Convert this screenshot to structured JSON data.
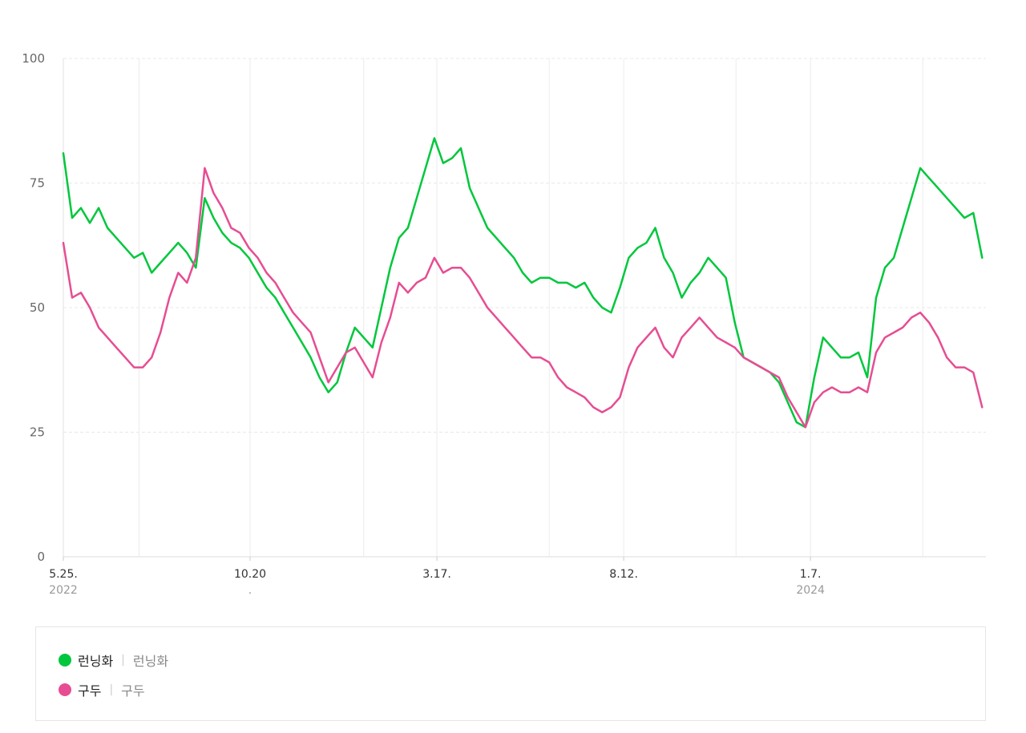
{
  "chart_data": {
    "type": "line",
    "title": "",
    "xlabel": "",
    "ylabel": "",
    "ylim": [
      0,
      100
    ],
    "yticks": [
      "0",
      "25",
      "50",
      "75",
      "100"
    ],
    "xlim": [
      "2022-05-25",
      "2024-05-25"
    ],
    "xticks": [
      {
        "date": "2022-05-25",
        "label": "5.25.",
        "sub": "2022"
      },
      {
        "date": "2022-10-20",
        "label": "10.20",
        "sub": "."
      },
      {
        "date": "2023-03-17",
        "label": "3.17.",
        "sub": ""
      },
      {
        "date": "2023-08-12",
        "label": "8.12.",
        "sub": ""
      },
      {
        "date": "2024-01-07",
        "label": "1.7.",
        "sub": "2024"
      }
    ],
    "vgrid_dates": [
      "2022-07-24",
      "2022-10-20",
      "2023-01-18",
      "2023-03-17",
      "2023-06-14",
      "2023-08-12",
      "2023-11-09",
      "2024-01-07",
      "2024-04-05"
    ],
    "grid": true,
    "legend_position": "bottom",
    "series": [
      {
        "name": "런닝화",
        "color": "#00c73c",
        "points": [
          [
            "2022-05-25",
            81
          ],
          [
            "2022-06-01",
            68
          ],
          [
            "2022-06-08",
            70
          ],
          [
            "2022-06-15",
            67
          ],
          [
            "2022-06-22",
            70
          ],
          [
            "2022-06-29",
            66
          ],
          [
            "2022-07-06",
            64
          ],
          [
            "2022-07-13",
            62
          ],
          [
            "2022-07-20",
            60
          ],
          [
            "2022-07-27",
            61
          ],
          [
            "2022-08-03",
            57
          ],
          [
            "2022-08-10",
            59
          ],
          [
            "2022-08-17",
            61
          ],
          [
            "2022-08-24",
            63
          ],
          [
            "2022-08-31",
            61
          ],
          [
            "2022-09-07",
            58
          ],
          [
            "2022-09-14",
            72
          ],
          [
            "2022-09-21",
            68
          ],
          [
            "2022-09-28",
            65
          ],
          [
            "2022-10-05",
            63
          ],
          [
            "2022-10-12",
            62
          ],
          [
            "2022-10-19",
            60
          ],
          [
            "2022-10-26",
            57
          ],
          [
            "2022-11-02",
            54
          ],
          [
            "2022-11-09",
            52
          ],
          [
            "2022-11-16",
            49
          ],
          [
            "2022-11-23",
            46
          ],
          [
            "2022-11-30",
            43
          ],
          [
            "2022-12-07",
            40
          ],
          [
            "2022-12-14",
            36
          ],
          [
            "2022-12-21",
            33
          ],
          [
            "2022-12-28",
            35
          ],
          [
            "2023-01-04",
            41
          ],
          [
            "2023-01-11",
            46
          ],
          [
            "2023-01-18",
            44
          ],
          [
            "2023-01-25",
            42
          ],
          [
            "2023-02-01",
            50
          ],
          [
            "2023-02-08",
            58
          ],
          [
            "2023-02-15",
            64
          ],
          [
            "2023-02-22",
            66
          ],
          [
            "2023-03-01",
            72
          ],
          [
            "2023-03-08",
            78
          ],
          [
            "2023-03-15",
            84
          ],
          [
            "2023-03-22",
            79
          ],
          [
            "2023-03-29",
            80
          ],
          [
            "2023-04-05",
            82
          ],
          [
            "2023-04-12",
            74
          ],
          [
            "2023-04-19",
            70
          ],
          [
            "2023-04-26",
            66
          ],
          [
            "2023-05-03",
            64
          ],
          [
            "2023-05-10",
            62
          ],
          [
            "2023-05-17",
            60
          ],
          [
            "2023-05-24",
            57
          ],
          [
            "2023-05-31",
            55
          ],
          [
            "2023-06-07",
            56
          ],
          [
            "2023-06-14",
            56
          ],
          [
            "2023-06-21",
            55
          ],
          [
            "2023-06-28",
            55
          ],
          [
            "2023-07-05",
            54
          ],
          [
            "2023-07-12",
            55
          ],
          [
            "2023-07-19",
            52
          ],
          [
            "2023-07-26",
            50
          ],
          [
            "2023-08-02",
            49
          ],
          [
            "2023-08-09",
            54
          ],
          [
            "2023-08-16",
            60
          ],
          [
            "2023-08-23",
            62
          ],
          [
            "2023-08-30",
            63
          ],
          [
            "2023-09-06",
            66
          ],
          [
            "2023-09-13",
            60
          ],
          [
            "2023-09-20",
            57
          ],
          [
            "2023-09-27",
            52
          ],
          [
            "2023-10-04",
            55
          ],
          [
            "2023-10-11",
            57
          ],
          [
            "2023-10-18",
            60
          ],
          [
            "2023-10-25",
            58
          ],
          [
            "2023-11-01",
            56
          ],
          [
            "2023-11-08",
            47
          ],
          [
            "2023-11-15",
            40
          ],
          [
            "2023-11-22",
            39
          ],
          [
            "2023-11-29",
            38
          ],
          [
            "2023-12-06",
            37
          ],
          [
            "2023-12-13",
            35
          ],
          [
            "2023-12-20",
            31
          ],
          [
            "2023-12-27",
            27
          ],
          [
            "2024-01-03",
            26
          ],
          [
            "2024-01-10",
            36
          ],
          [
            "2024-01-17",
            44
          ],
          [
            "2024-01-24",
            42
          ],
          [
            "2024-01-31",
            40
          ],
          [
            "2024-02-07",
            40
          ],
          [
            "2024-02-14",
            41
          ],
          [
            "2024-02-21",
            36
          ],
          [
            "2024-02-28",
            52
          ],
          [
            "2024-03-06",
            58
          ],
          [
            "2024-03-13",
            60
          ],
          [
            "2024-03-20",
            66
          ],
          [
            "2024-03-27",
            72
          ],
          [
            "2024-04-03",
            78
          ],
          [
            "2024-04-10",
            76
          ],
          [
            "2024-04-17",
            74
          ],
          [
            "2024-04-24",
            72
          ],
          [
            "2024-05-01",
            70
          ],
          [
            "2024-05-08",
            68
          ],
          [
            "2024-05-15",
            69
          ],
          [
            "2024-05-22",
            60
          ]
        ]
      },
      {
        "name": "구두",
        "color": "#e64d93",
        "points": [
          [
            "2022-05-25",
            63
          ],
          [
            "2022-06-01",
            52
          ],
          [
            "2022-06-08",
            53
          ],
          [
            "2022-06-15",
            50
          ],
          [
            "2022-06-22",
            46
          ],
          [
            "2022-06-29",
            44
          ],
          [
            "2022-07-06",
            42
          ],
          [
            "2022-07-13",
            40
          ],
          [
            "2022-07-20",
            38
          ],
          [
            "2022-07-27",
            38
          ],
          [
            "2022-08-03",
            40
          ],
          [
            "2022-08-10",
            45
          ],
          [
            "2022-08-17",
            52
          ],
          [
            "2022-08-24",
            57
          ],
          [
            "2022-08-31",
            55
          ],
          [
            "2022-09-07",
            60
          ],
          [
            "2022-09-14",
            78
          ],
          [
            "2022-09-21",
            73
          ],
          [
            "2022-09-28",
            70
          ],
          [
            "2022-10-05",
            66
          ],
          [
            "2022-10-12",
            65
          ],
          [
            "2022-10-19",
            62
          ],
          [
            "2022-10-26",
            60
          ],
          [
            "2022-11-02",
            57
          ],
          [
            "2022-11-09",
            55
          ],
          [
            "2022-11-16",
            52
          ],
          [
            "2022-11-23",
            49
          ],
          [
            "2022-11-30",
            47
          ],
          [
            "2022-12-07",
            45
          ],
          [
            "2022-12-14",
            40
          ],
          [
            "2022-12-21",
            35
          ],
          [
            "2022-12-28",
            38
          ],
          [
            "2023-01-04",
            41
          ],
          [
            "2023-01-11",
            42
          ],
          [
            "2023-01-18",
            39
          ],
          [
            "2023-01-25",
            36
          ],
          [
            "2023-02-01",
            43
          ],
          [
            "2023-02-08",
            48
          ],
          [
            "2023-02-15",
            55
          ],
          [
            "2023-02-22",
            53
          ],
          [
            "2023-03-01",
            55
          ],
          [
            "2023-03-08",
            56
          ],
          [
            "2023-03-15",
            60
          ],
          [
            "2023-03-22",
            57
          ],
          [
            "2023-03-29",
            58
          ],
          [
            "2023-04-05",
            58
          ],
          [
            "2023-04-12",
            56
          ],
          [
            "2023-04-19",
            53
          ],
          [
            "2023-04-26",
            50
          ],
          [
            "2023-05-03",
            48
          ],
          [
            "2023-05-10",
            46
          ],
          [
            "2023-05-17",
            44
          ],
          [
            "2023-05-24",
            42
          ],
          [
            "2023-05-31",
            40
          ],
          [
            "2023-06-07",
            40
          ],
          [
            "2023-06-14",
            39
          ],
          [
            "2023-06-21",
            36
          ],
          [
            "2023-06-28",
            34
          ],
          [
            "2023-07-05",
            33
          ],
          [
            "2023-07-12",
            32
          ],
          [
            "2023-07-19",
            30
          ],
          [
            "2023-07-26",
            29
          ],
          [
            "2023-08-02",
            30
          ],
          [
            "2023-08-09",
            32
          ],
          [
            "2023-08-16",
            38
          ],
          [
            "2023-08-23",
            42
          ],
          [
            "2023-08-30",
            44
          ],
          [
            "2023-09-06",
            46
          ],
          [
            "2023-09-13",
            42
          ],
          [
            "2023-09-20",
            40
          ],
          [
            "2023-09-27",
            44
          ],
          [
            "2023-10-04",
            46
          ],
          [
            "2023-10-11",
            48
          ],
          [
            "2023-10-18",
            46
          ],
          [
            "2023-10-25",
            44
          ],
          [
            "2023-11-01",
            43
          ],
          [
            "2023-11-08",
            42
          ],
          [
            "2023-11-15",
            40
          ],
          [
            "2023-11-22",
            39
          ],
          [
            "2023-11-29",
            38
          ],
          [
            "2023-12-06",
            37
          ],
          [
            "2023-12-13",
            36
          ],
          [
            "2023-12-20",
            32
          ],
          [
            "2023-12-27",
            29
          ],
          [
            "2024-01-03",
            26
          ],
          [
            "2024-01-10",
            31
          ],
          [
            "2024-01-17",
            33
          ],
          [
            "2024-01-24",
            34
          ],
          [
            "2024-01-31",
            33
          ],
          [
            "2024-02-07",
            33
          ],
          [
            "2024-02-14",
            34
          ],
          [
            "2024-02-21",
            33
          ],
          [
            "2024-02-28",
            41
          ],
          [
            "2024-03-06",
            44
          ],
          [
            "2024-03-13",
            45
          ],
          [
            "2024-03-20",
            46
          ],
          [
            "2024-03-27",
            48
          ],
          [
            "2024-04-03",
            49
          ],
          [
            "2024-04-10",
            47
          ],
          [
            "2024-04-17",
            44
          ],
          [
            "2024-04-24",
            40
          ],
          [
            "2024-05-01",
            38
          ],
          [
            "2024-05-08",
            38
          ],
          [
            "2024-05-15",
            37
          ],
          [
            "2024-05-22",
            30
          ]
        ]
      }
    ]
  },
  "legend": {
    "items": [
      {
        "name": "런닝화",
        "sub": "런닝화",
        "color": "#00c73c"
      },
      {
        "name": "구두",
        "sub": "구두",
        "color": "#e64d93"
      }
    ]
  }
}
